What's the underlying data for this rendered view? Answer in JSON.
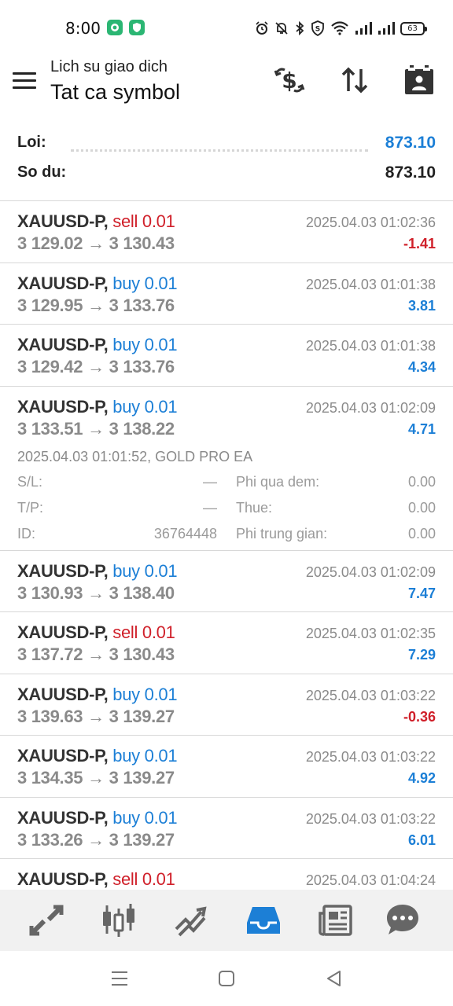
{
  "status_bar": {
    "time": "8:00",
    "battery": "63"
  },
  "header": {
    "subtitle": "Lich su giao dich",
    "title": "Tat ca symbol",
    "icons": [
      "menu-icon",
      "dollar-exchange-icon",
      "sort-icon",
      "calendar-icon"
    ]
  },
  "summary": {
    "profit_label": "Loi:",
    "profit_value": "873.10",
    "balance_label": "So du:",
    "balance_value": "873.10"
  },
  "trades": [
    {
      "symbol": "XAUUSD-P,",
      "dir": "sell 0.01",
      "time": "2025.04.03 01:02:36",
      "open": "3 129.02",
      "arrow": "→",
      "close": "3 130.43",
      "profit": "-1.41"
    },
    {
      "symbol": "XAUUSD-P,",
      "dir": "buy 0.01",
      "time": "2025.04.03 01:01:38",
      "open": "3 129.95",
      "arrow": "→",
      "close": "3 133.76",
      "profit": "3.81"
    },
    {
      "symbol": "XAUUSD-P,",
      "dir": "buy 0.01",
      "time": "2025.04.03 01:01:38",
      "open": "3 129.42",
      "arrow": "→",
      "close": "3 133.76",
      "profit": "4.34"
    },
    {
      "symbol": "XAUUSD-P,",
      "dir": "buy 0.01",
      "time": "2025.04.03 01:02:09",
      "open": "3 133.51",
      "arrow": "→",
      "close": "3 138.22",
      "profit": "4.71"
    },
    {
      "symbol": "XAUUSD-P,",
      "dir": "buy 0.01",
      "time": "2025.04.03 01:02:09",
      "open": "3 130.93",
      "arrow": "→",
      "close": "3 138.40",
      "profit": "7.47"
    },
    {
      "symbol": "XAUUSD-P,",
      "dir": "sell 0.01",
      "time": "2025.04.03 01:02:35",
      "open": "3 137.72",
      "arrow": "→",
      "close": "3 130.43",
      "profit": "7.29"
    },
    {
      "symbol": "XAUUSD-P,",
      "dir": "buy 0.01",
      "time": "2025.04.03 01:03:22",
      "open": "3 139.63",
      "arrow": "→",
      "close": "3 139.27",
      "profit": "-0.36"
    },
    {
      "symbol": "XAUUSD-P,",
      "dir": "buy 0.01",
      "time": "2025.04.03 01:03:22",
      "open": "3 134.35",
      "arrow": "→",
      "close": "3 139.27",
      "profit": "4.92"
    },
    {
      "symbol": "XAUUSD-P,",
      "dir": "buy 0.01",
      "time": "2025.04.03 01:03:22",
      "open": "3 133.26",
      "arrow": "→",
      "close": "3 139.27",
      "profit": "6.01"
    },
    {
      "symbol": "XAUUSD-P,",
      "dir": "sell 0.01",
      "time": "2025.04.03 01:04:24",
      "open": "",
      "arrow": "",
      "close": "",
      "profit": ""
    }
  ],
  "expanded_detail": {
    "opened": "2025.04.03 01:01:52, GOLD PRO EA",
    "sl_label": "S/L:",
    "sl_value": "—",
    "tp_label": "T/P:",
    "tp_value": "—",
    "id_label": "ID:",
    "id_value": "36764448",
    "swap_label": "Phi qua dem:",
    "swap_value": "0.00",
    "tax_label": "Thue:",
    "tax_value": "0.00",
    "commission_label": "Phi trung gian:",
    "commission_value": "0.00"
  },
  "colors": {
    "sell": "#d0202a",
    "buy": "#1c7fd6",
    "active_tab": "#1c7fd6"
  },
  "bottom_nav": {
    "icons": [
      "quotes-icon",
      "chart-icon",
      "trade-icon",
      "history-icon",
      "news-icon",
      "chat-icon"
    ],
    "active": "history-icon"
  }
}
